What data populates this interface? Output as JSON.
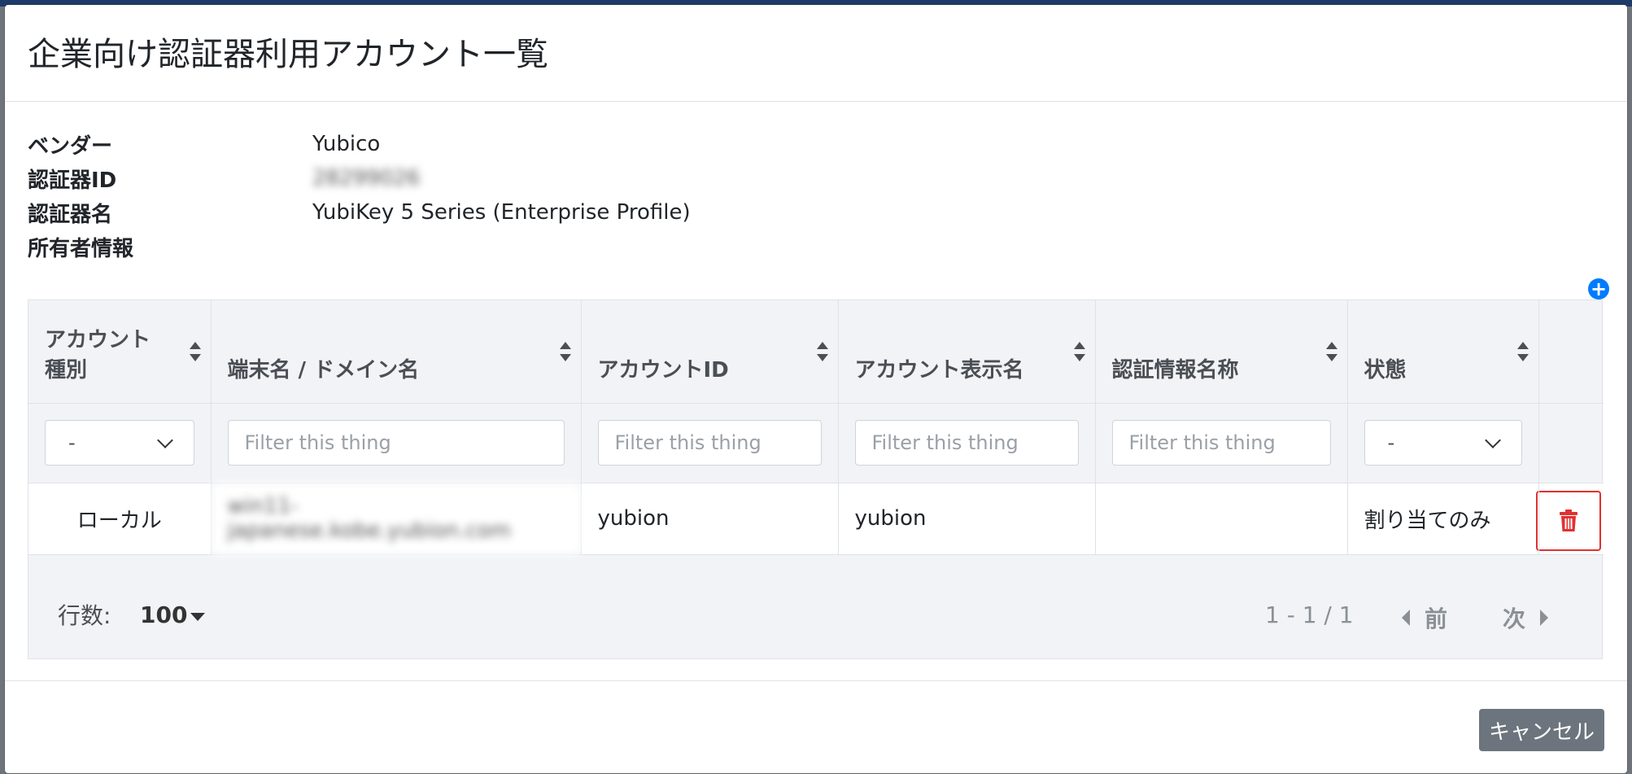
{
  "modal": {
    "title": "企業向け認証器利用アカウント一覧"
  },
  "info": {
    "vendor_label": "ベンダー",
    "vendor_value": "Yubico",
    "authenticator_id_label": "認証器ID",
    "authenticator_id_value": "28299026",
    "authenticator_name_label": "認証器名",
    "authenticator_name_value": "YubiKey 5 Series (Enterprise Profile)",
    "owner_label": "所有者情報",
    "owner_value": ""
  },
  "table": {
    "columns": [
      {
        "line1": "アカウント",
        "line2": "種別"
      },
      {
        "label": "端末名 / ドメイン名"
      },
      {
        "label": "アカウントID"
      },
      {
        "label": "アカウント表示名"
      },
      {
        "label": "認証情報名称"
      },
      {
        "label": "状態"
      }
    ],
    "filters": {
      "account_type": "-",
      "placeholder": "Filter this thing",
      "status": "-"
    },
    "rows": [
      {
        "account_type": "ローカル",
        "device_domain": "win11-japanese.kobe.yubion.com",
        "account_id": "yubion",
        "display_name": "yubion",
        "credential_name": "",
        "status": "割り当てのみ"
      }
    ]
  },
  "pager": {
    "rows_label": "行数:",
    "rows_value": "100",
    "range": "1 - 1 / 1",
    "prev": "前",
    "next": "次"
  },
  "footer": {
    "cancel": "キャンセル"
  },
  "colors": {
    "primary": "#007bff",
    "danger": "#e03131",
    "secondary": "#6c757d"
  },
  "icons": {
    "add": "plus-circle-icon",
    "delete": "trash-icon",
    "sort": "sort-icon"
  }
}
